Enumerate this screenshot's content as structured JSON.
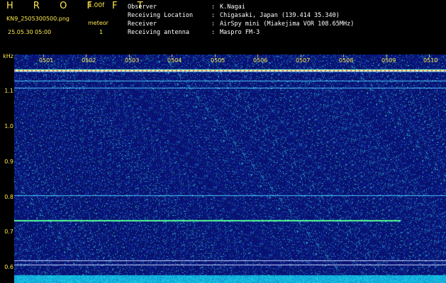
{
  "header": {
    "title": "H R O F F T",
    "version": "1.00f",
    "filename": "KN9_2505300500.png",
    "datetime": "25.05.30 05:00",
    "meteor_label": "meteor",
    "meteor_count": "1"
  },
  "info": [
    {
      "key": "Observer",
      "value": "K.Nagai"
    },
    {
      "key": "Receiving Location",
      "value": "Chigasaki, Japan (139.414 35.340)"
    },
    {
      "key": "Receiver",
      "value": "AirSpy mini (Miakejima VOR 108.65MHz)"
    },
    {
      "key": "Receiving antenna",
      "value": "Maspro FM-3"
    }
  ],
  "colors": {
    "text_yellow": "#ffe94d",
    "text_white": "#ffffff",
    "background": "#000000",
    "noise_base": "#0a1a7a"
  },
  "spectrogram": {
    "y_unit": "kHz",
    "y_ticks": [
      "1.1",
      "1.0",
      "0.9",
      "0.8",
      "0.7",
      "0.6"
    ],
    "x_ticks": [
      "0501",
      "0502",
      "0503",
      "0504",
      "0505",
      "0506",
      "0507",
      "0508",
      "0509",
      "0510"
    ],
    "freq_range_khz": [
      0.58,
      1.15
    ],
    "carrier_lines_khz": [
      1.115,
      1.09,
      1.07,
      0.79,
      0.725,
      0.62,
      0.61
    ]
  }
}
